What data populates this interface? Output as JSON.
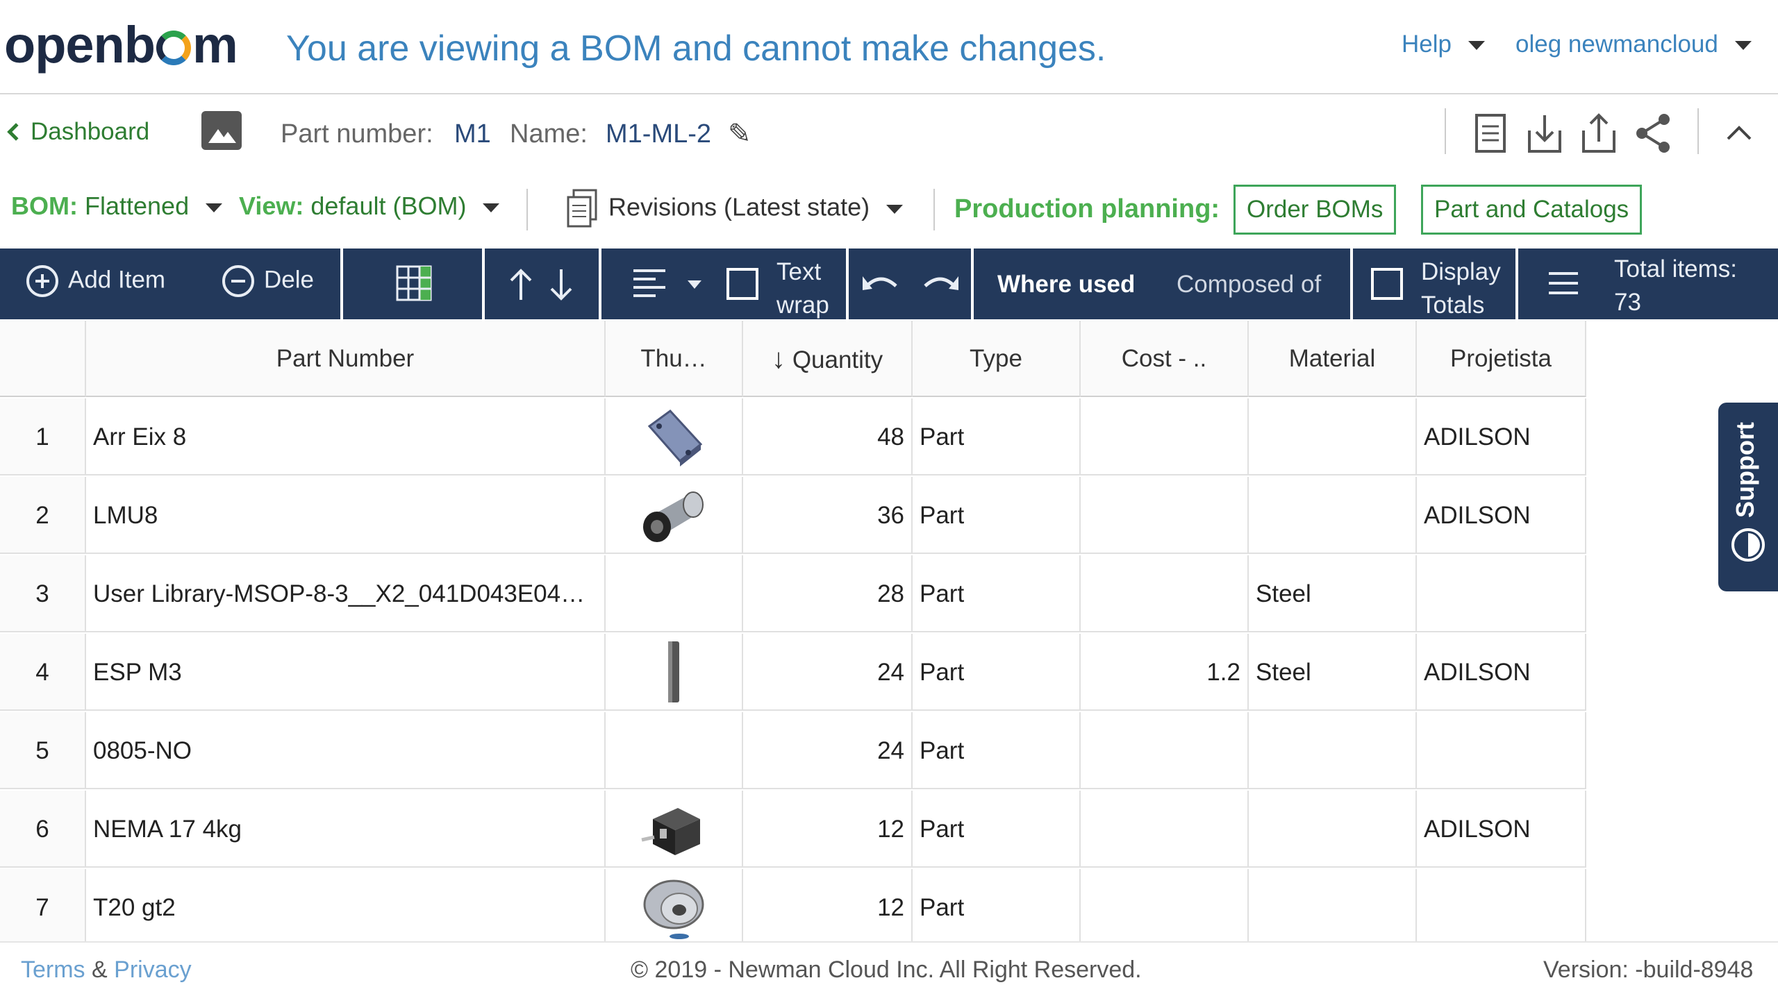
{
  "header": {
    "logo": "openbom",
    "banner": "You are viewing a BOM and cannot make changes.",
    "help_label": "Help",
    "user_label": "oleg newmancloud"
  },
  "part_bar": {
    "back_label": "Dashboard",
    "part_number_label": "Part number:",
    "part_number_value": "M1",
    "name_label": "Name:",
    "name_value": "M1-ML-2",
    "icons": [
      "image-icon",
      "pencil-icon",
      "document-icon",
      "download-icon",
      "upload-icon",
      "share-icon",
      "collapse-icon"
    ]
  },
  "bom_bar": {
    "bom_label": "BOM:",
    "bom_value": "Flattened",
    "view_label": "View:",
    "view_value": "default (BOM)",
    "revisions_label": "Revisions (Latest state)",
    "production_label": "Production planning:",
    "order_boms": "Order BOMs",
    "part_catalogs": "Part and Catalogs"
  },
  "toolbar": {
    "add_item": "Add Item",
    "delete": "Dele",
    "text_wrap_1": "Text",
    "text_wrap_2": "wrap",
    "where_used": "Where used",
    "composed_of": "Composed of",
    "display_totals_1": "Display",
    "display_totals_2": "Totals",
    "total_items_label": "Total items:",
    "total_items_value": "73"
  },
  "table": {
    "columns": [
      "",
      "Part Number",
      "Thu…",
      "Quantity",
      "Type",
      "Cost - ..",
      "Material",
      "Projetista"
    ],
    "rows": [
      {
        "idx": "1",
        "part": "Arr Eix 8",
        "qty": "48",
        "type": "Part",
        "cost": "",
        "material": "",
        "proj": "ADILSON",
        "thumb": "plate"
      },
      {
        "idx": "2",
        "part": "LMU8",
        "qty": "36",
        "type": "Part",
        "cost": "",
        "material": "",
        "proj": "ADILSON",
        "thumb": "bearing"
      },
      {
        "idx": "3",
        "part": "User Library-MSOP-8-3__X2_041D043E04…",
        "qty": "28",
        "type": "Part",
        "cost": "",
        "material": "Steel",
        "proj": "",
        "thumb": ""
      },
      {
        "idx": "4",
        "part": "ESP M3",
        "qty": "24",
        "type": "Part",
        "cost": "1.2",
        "material": "Steel",
        "proj": "ADILSON",
        "thumb": "rod"
      },
      {
        "idx": "5",
        "part": "0805-NO",
        "qty": "24",
        "type": "Part",
        "cost": "",
        "material": "",
        "proj": "",
        "thumb": ""
      },
      {
        "idx": "6",
        "part": "NEMA 17 4kg",
        "qty": "12",
        "type": "Part",
        "cost": "",
        "material": "",
        "proj": "ADILSON",
        "thumb": "motor"
      },
      {
        "idx": "7",
        "part": "T20 gt2",
        "qty": "12",
        "type": "Part",
        "cost": "",
        "material": "",
        "proj": "",
        "thumb": "pulley"
      }
    ]
  },
  "support_label": "Support",
  "footer": {
    "terms": "Terms",
    "amp": "&",
    "privacy": "Privacy",
    "copyright": "© 2019 - Newman Cloud Inc. All Right Reserved.",
    "version": "Version: -build-8948"
  }
}
